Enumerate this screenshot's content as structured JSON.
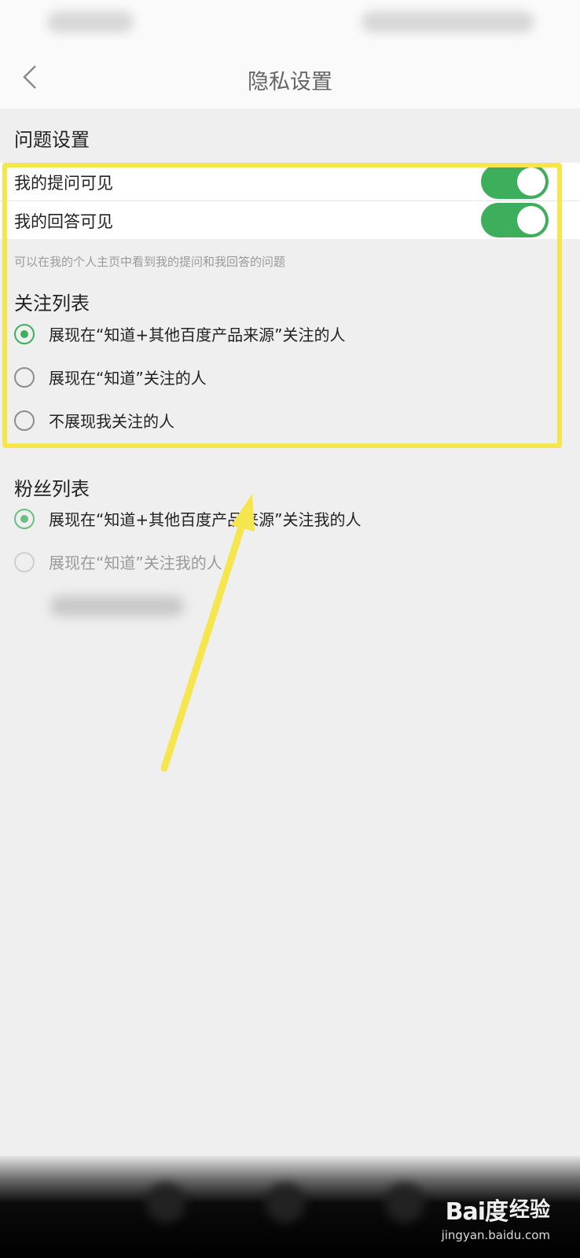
{
  "nav": {
    "title": "隐私设置"
  },
  "question_settings": {
    "title": "问题设置",
    "toggles": [
      {
        "label": "我的提问可见",
        "on": true
      },
      {
        "label": "我的回答可见",
        "on": true
      }
    ],
    "hint": "可以在我的个人主页中看到我的提问和我回答的问题"
  },
  "follow_list": {
    "title": "关注列表",
    "options": [
      {
        "label": "展现在“知道+其他百度产品来源”关注的人",
        "selected": true
      },
      {
        "label": "展现在“知道”关注的人",
        "selected": false
      },
      {
        "label": "不展现我关注的人",
        "selected": false
      }
    ]
  },
  "fans_list": {
    "title": "粉丝列表",
    "options": [
      {
        "label": "展现在“知道+其他百度产品来源”关注我的人",
        "selected": true
      },
      {
        "label": "展现在“知道”关注我的人",
        "selected": false
      }
    ]
  },
  "colors": {
    "accent": "#3daf5c",
    "highlight": "#f5e650",
    "arrow": "#f5e650"
  },
  "watermark": {
    "logo": "Bai度",
    "brand": "经验",
    "domain": "jingyan.baidu.com"
  }
}
